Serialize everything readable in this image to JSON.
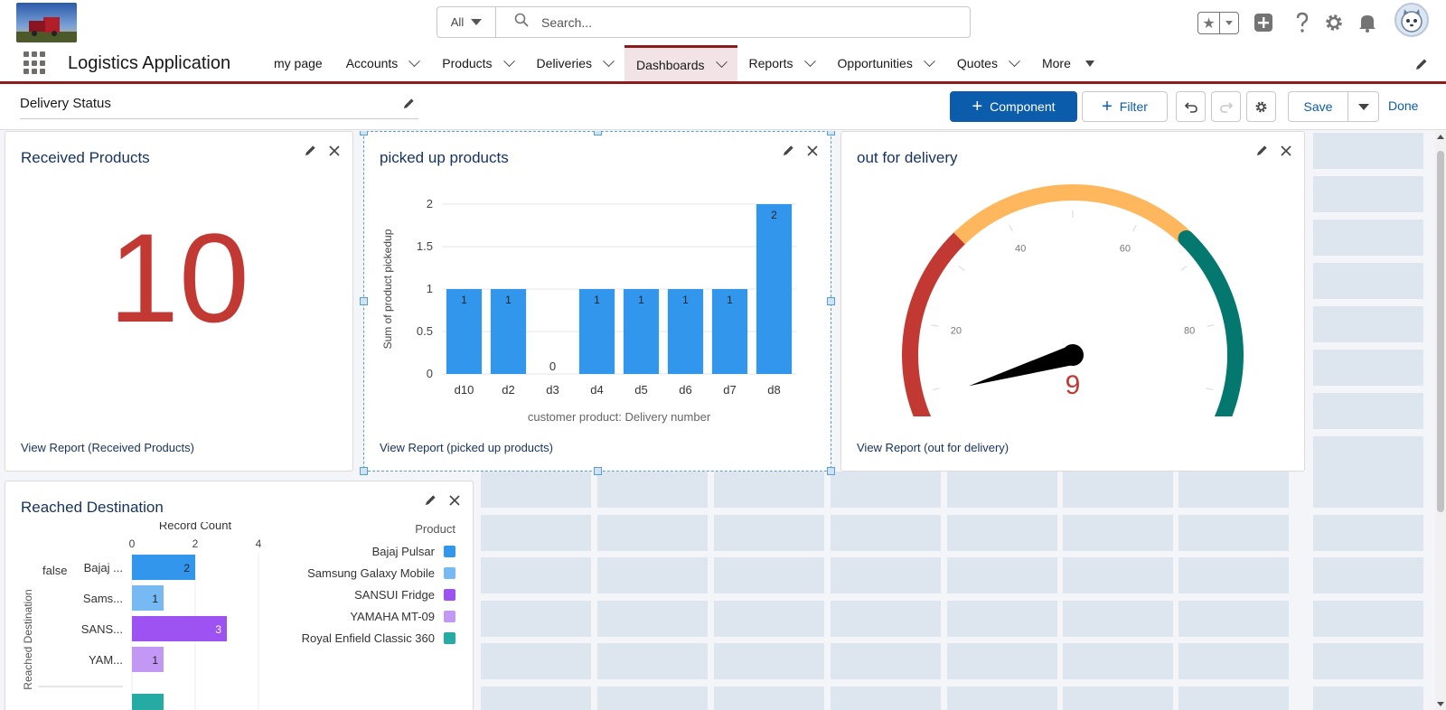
{
  "header": {
    "search": {
      "scope": "All",
      "placeholder": "Search..."
    }
  },
  "nav": {
    "app_name": "Logistics Application",
    "items": [
      {
        "label": "my page",
        "dropdown": false,
        "active": false
      },
      {
        "label": "Accounts",
        "dropdown": true,
        "active": false
      },
      {
        "label": "Products",
        "dropdown": true,
        "active": false
      },
      {
        "label": "Deliveries",
        "dropdown": true,
        "active": false
      },
      {
        "label": "Dashboards",
        "dropdown": true,
        "active": true
      },
      {
        "label": "Reports",
        "dropdown": true,
        "active": false
      },
      {
        "label": "Opportunities",
        "dropdown": true,
        "active": false
      },
      {
        "label": "Quotes",
        "dropdown": true,
        "active": false
      },
      {
        "label": "More",
        "dropdown": true,
        "active": false
      }
    ]
  },
  "toolbar": {
    "dashboard_title": "Delivery Status",
    "component_label": "Component",
    "filter_label": "Filter",
    "save_label": "Save",
    "done_label": "Done"
  },
  "colors": {
    "brand": "#0b5cab",
    "nav_accent": "#8e1b1b",
    "metric": "#c23934",
    "bar": "#3296ed"
  },
  "widgets": {
    "received": {
      "title": "Received Products",
      "value": "10",
      "view_report": "View Report (Received Products)"
    },
    "picked": {
      "title": "picked up products",
      "view_report": "View Report (picked up products)"
    },
    "out": {
      "title": "out for delivery",
      "view_report": "View Report (out for delivery)"
    },
    "reached": {
      "title": "Reached Destination"
    }
  },
  "chart_data": [
    {
      "type": "bar",
      "title": "picked up products",
      "xlabel": "customer product: Delivery number",
      "ylabel": "Sum of product pickedup",
      "categories": [
        "d10",
        "d2",
        "d3",
        "d4",
        "d5",
        "d6",
        "d7",
        "d8"
      ],
      "values": [
        1,
        1,
        0,
        1,
        1,
        1,
        1,
        2
      ],
      "y_ticks": [
        "0",
        "0.5",
        "1",
        "1.5",
        "2"
      ],
      "ylim": [
        0,
        2
      ],
      "grid": true
    },
    {
      "type": "gauge",
      "title": "out for delivery",
      "value": 9,
      "value_label": "9",
      "min": 0,
      "max": 100,
      "ticks": [
        "0",
        "20",
        "40",
        "60",
        "80",
        "100"
      ],
      "bands": [
        {
          "from": 0,
          "to": 33,
          "color": "#c23934"
        },
        {
          "from": 33,
          "to": 67,
          "color": "#ffb75d"
        },
        {
          "from": 67,
          "to": 100,
          "color": "#04786e"
        }
      ]
    },
    {
      "type": "bar",
      "orientation": "horizontal",
      "title": "Reached Destination",
      "xlabel": "Record Count",
      "ylabel": "Reached Destination",
      "group": "false",
      "x_ticks": [
        "0",
        "2",
        "4"
      ],
      "xlim": [
        0,
        4
      ],
      "categories": [
        "Bajaj ...",
        "Sams...",
        "SANS...",
        "YAM..."
      ],
      "values": [
        2,
        1,
        3,
        1
      ],
      "value_labels": [
        "2",
        "1",
        "3",
        "1"
      ],
      "colors": [
        "#3296ed",
        "#77b9f2",
        "#9d53f2",
        "#c398f5"
      ],
      "legend": {
        "title": "Product",
        "position": "right",
        "items": [
          {
            "name": "Bajaj Pulsar",
            "color": "#3296ed"
          },
          {
            "name": "Samsung Galaxy Mobile",
            "color": "#77b9f2"
          },
          {
            "name": "SANSUI Fridge",
            "color": "#9d53f2"
          },
          {
            "name": "YAMAHA MT-09",
            "color": "#c398f5"
          },
          {
            "name": "Royal Enfield Classic 360",
            "color": "#26aba4"
          }
        ]
      }
    }
  ]
}
